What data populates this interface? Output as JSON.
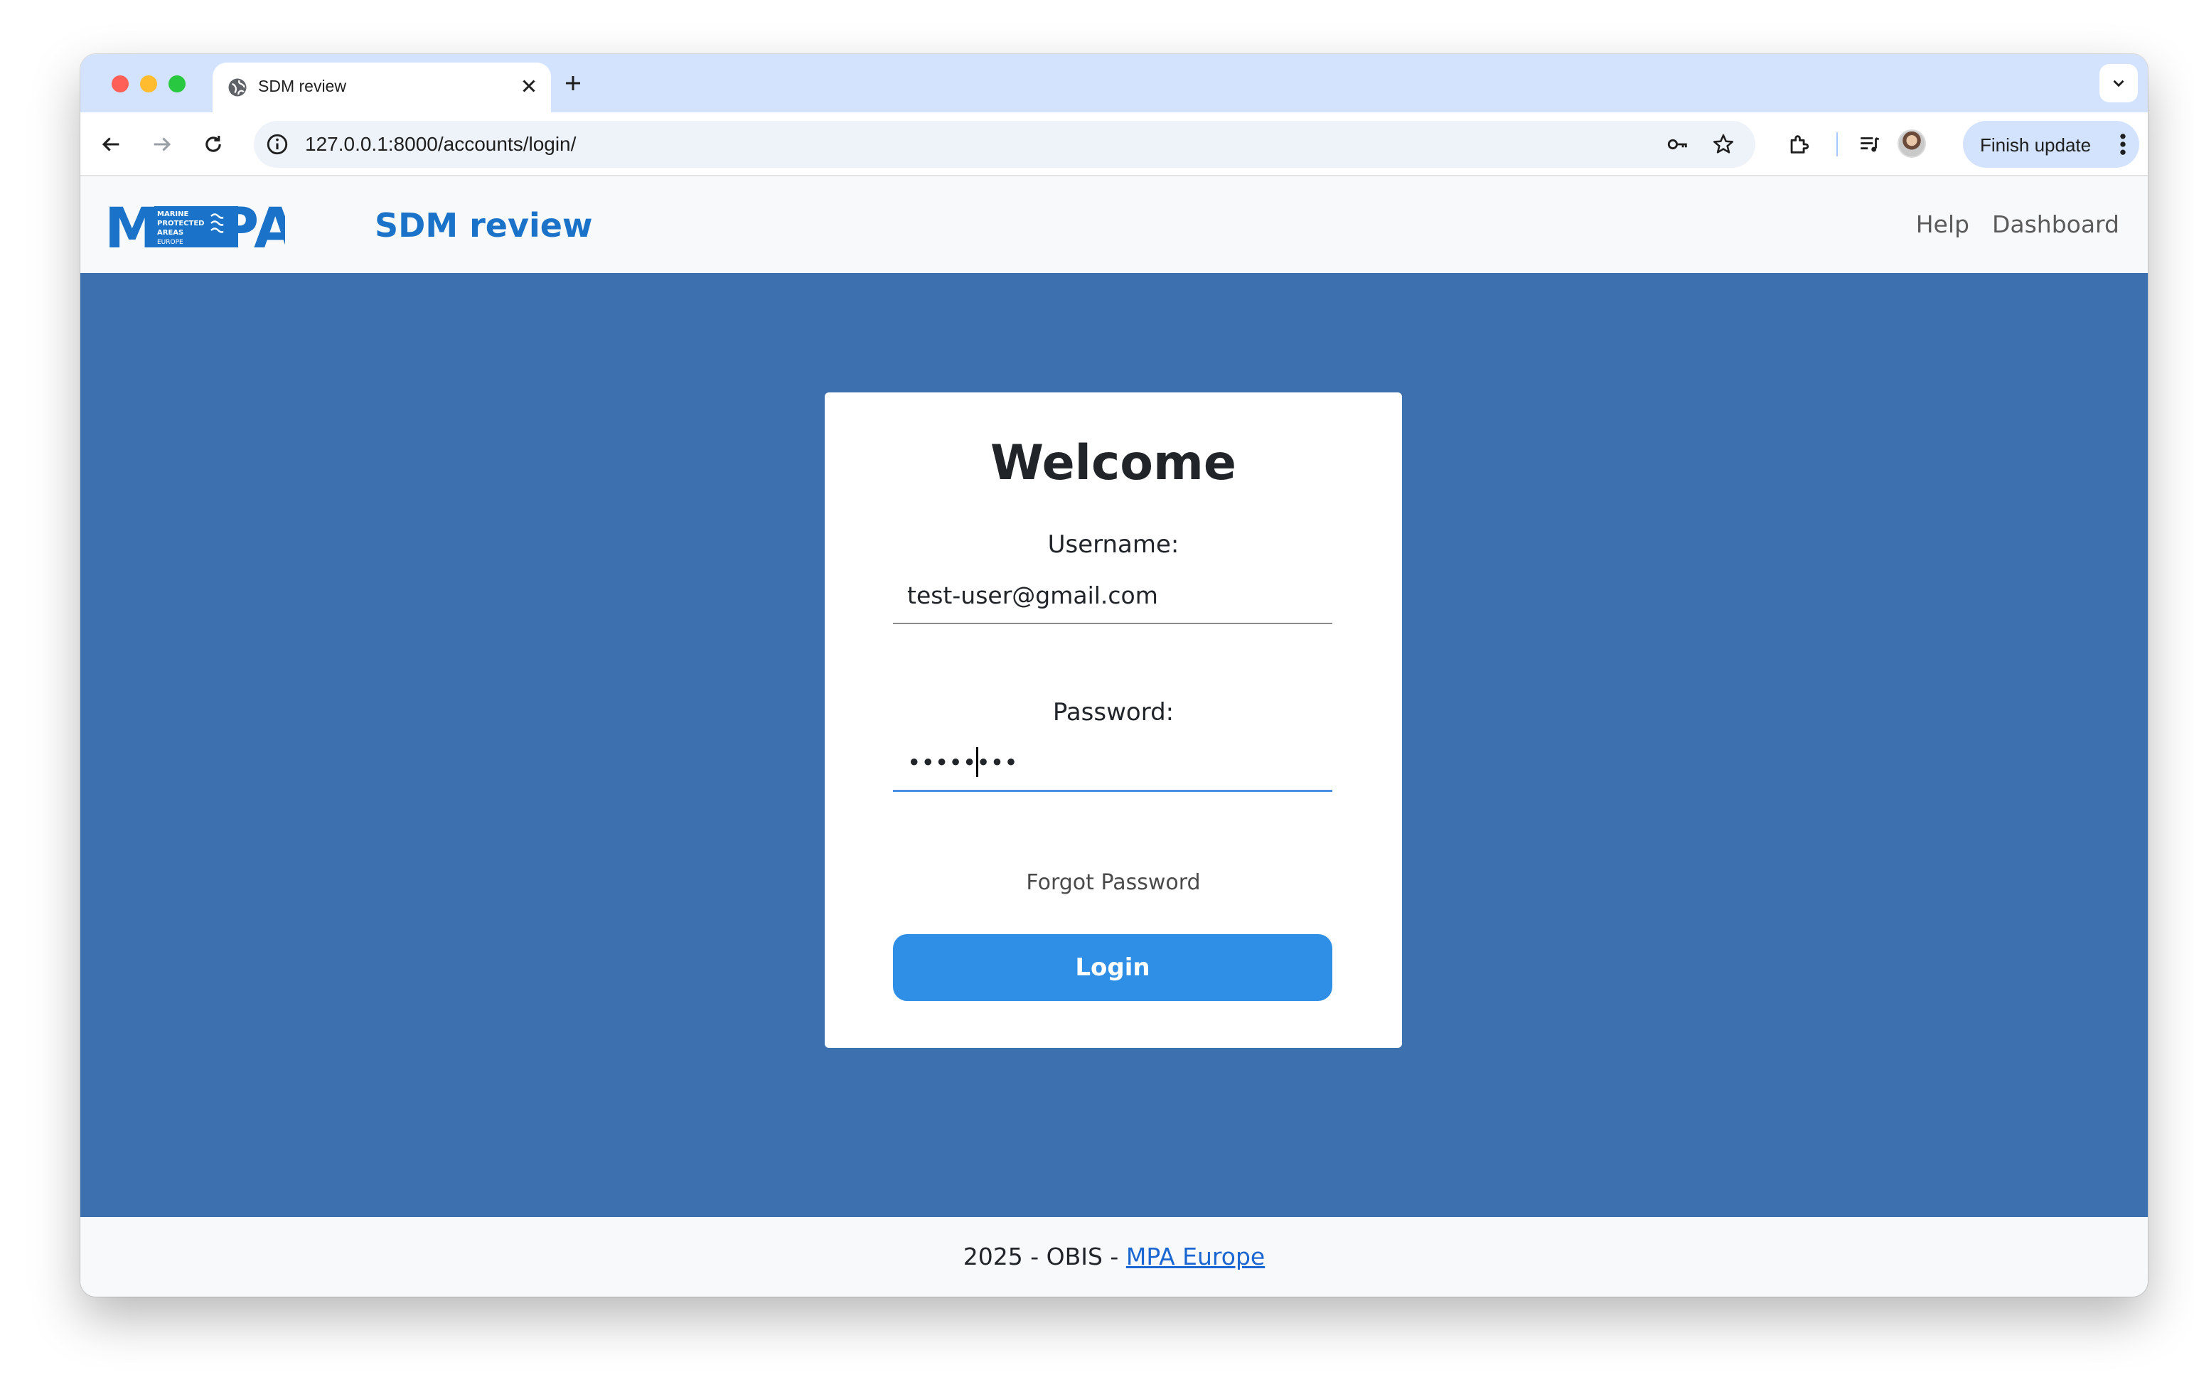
{
  "browser": {
    "tab_title": "SDM review",
    "url": "127.0.0.1:8000/accounts/login/",
    "finish_update_label": "Finish update"
  },
  "header": {
    "logo_text": "MPA",
    "logo_subtext": [
      "MARINE",
      "PROTECTED",
      "AREAS",
      "EUROPE"
    ],
    "brand": "SDM review",
    "nav": [
      "Help",
      "Dashboard"
    ]
  },
  "login": {
    "title": "Welcome",
    "username_label": "Username:",
    "username_value": "test-user@gmail.com",
    "password_label": "Password:",
    "password_value": "password",
    "forgot_label": "Forgot Password",
    "login_button": "Login"
  },
  "footer": {
    "text": "2025 - OBIS - ",
    "link": "MPA Europe"
  },
  "colors": {
    "hero_bg": "#3d70ae",
    "brand": "#1a73c8",
    "login_button": "#2f8ee5",
    "tabstrip": "#d3e3fd"
  }
}
